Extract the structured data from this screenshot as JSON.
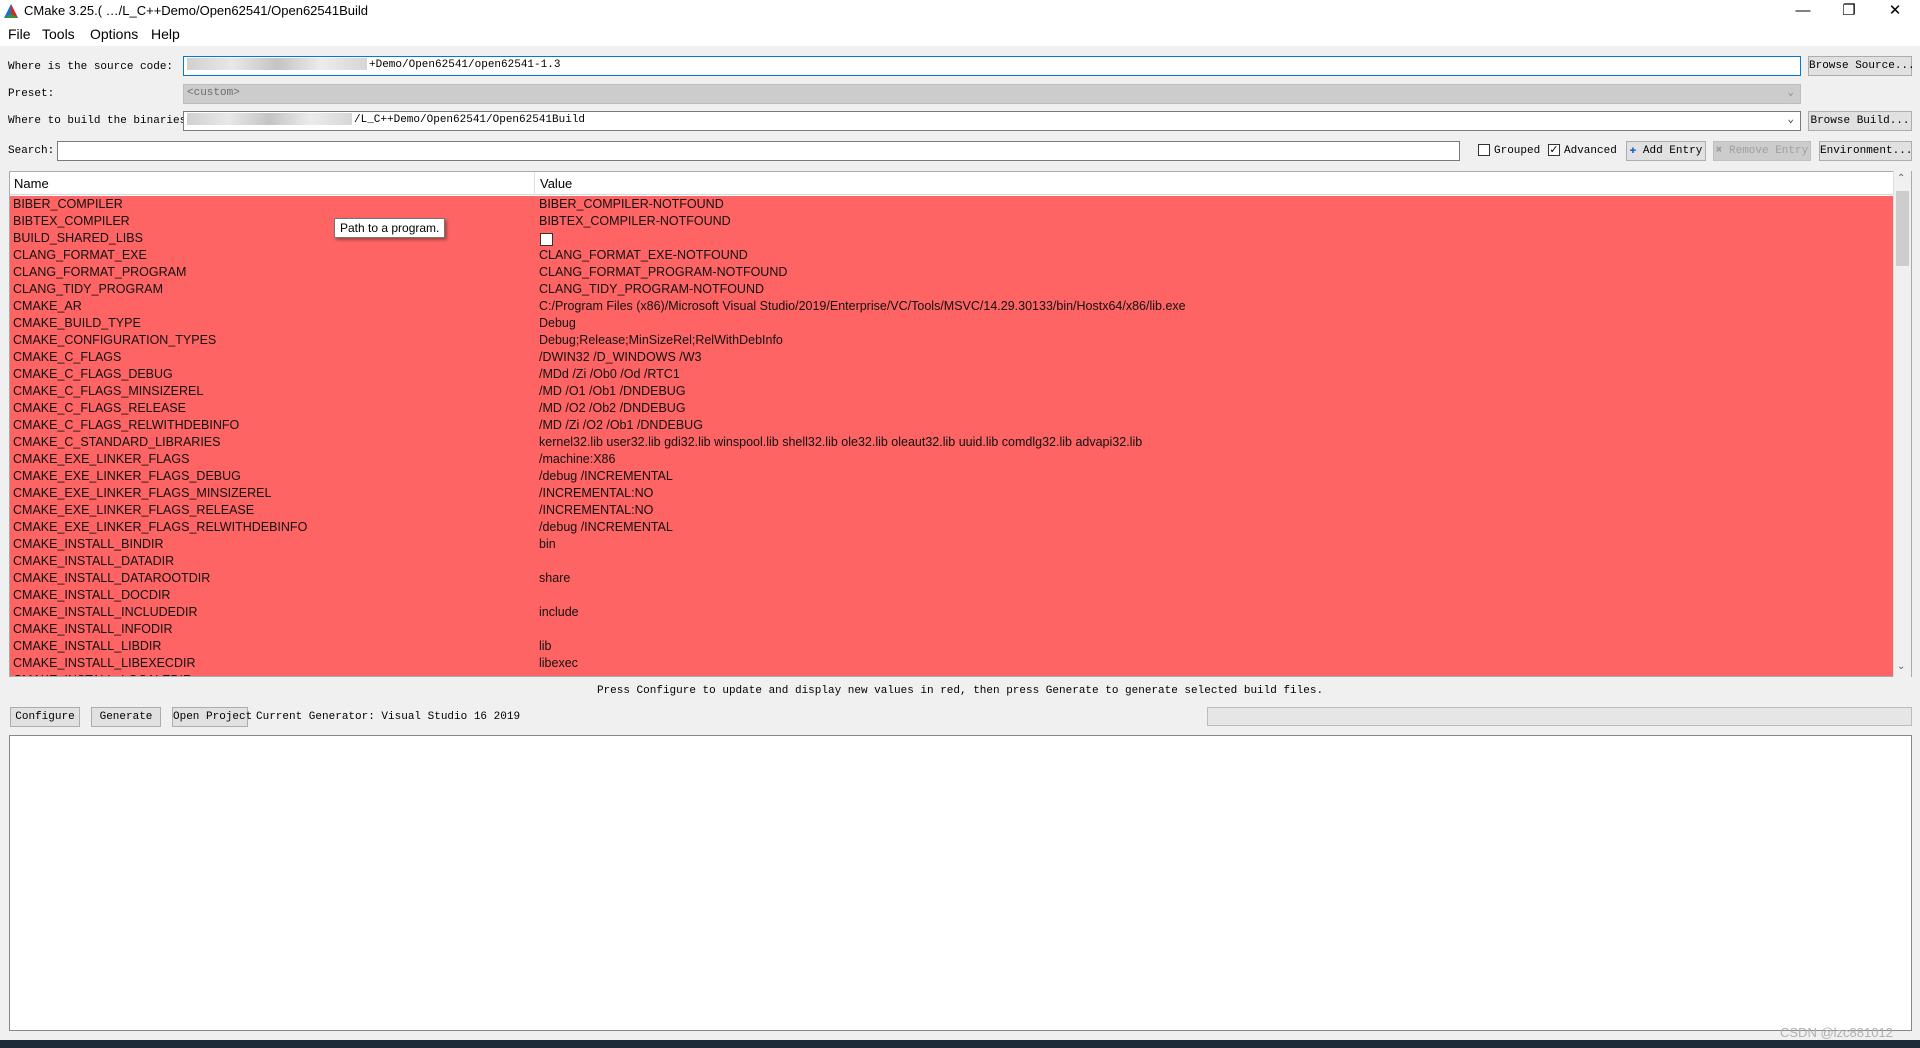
{
  "window": {
    "title": "CMake 3.25.( …/L_C++Demo/Open62541/Open62541Build",
    "minimize_glyph": "—",
    "restore_glyph": "❐",
    "close_glyph": "✕",
    "app_icon": "cmake-triangle-icon"
  },
  "menu": {
    "file": "File",
    "tools": "Tools",
    "options": "Options",
    "help": "Help"
  },
  "source": {
    "label": "Where is the source code:",
    "value": "+Demo/Open62541/open62541-1.3",
    "button": "Browse Source..."
  },
  "preset": {
    "label": "Preset:",
    "value": "<custom>"
  },
  "binaries": {
    "label": "Where to build the binaries:",
    "value": "/L_C++Demo/Open62541/Open62541Build",
    "button": "Browse Build..."
  },
  "search": {
    "label": "Search:",
    "value": "",
    "grouped": "Grouped",
    "grouped_checked": false,
    "advanced": "Advanced",
    "advanced_checked": true,
    "add_entry": "Add Entry",
    "remove_entry": "Remove Entry",
    "environment": "Environment..."
  },
  "table": {
    "col_name": "Name",
    "col_value": "Value",
    "row_color": "#ff6464",
    "rows": [
      {
        "name": "BIBER_COMPILER",
        "value": "BIBER_COMPILER-NOTFOUND"
      },
      {
        "name": "BIBTEX_COMPILER",
        "value": "BIBTEX_COMPILER-NOTFOUND"
      },
      {
        "name": "BUILD_SHARED_LIBS",
        "value": "",
        "checkbox": true
      },
      {
        "name": "CLANG_FORMAT_EXE",
        "value": "CLANG_FORMAT_EXE-NOTFOUND"
      },
      {
        "name": "CLANG_FORMAT_PROGRAM",
        "value": "CLANG_FORMAT_PROGRAM-NOTFOUND"
      },
      {
        "name": "CLANG_TIDY_PROGRAM",
        "value": "CLANG_TIDY_PROGRAM-NOTFOUND"
      },
      {
        "name": "CMAKE_AR",
        "value": "C:/Program Files (x86)/Microsoft Visual Studio/2019/Enterprise/VC/Tools/MSVC/14.29.30133/bin/Hostx64/x86/lib.exe"
      },
      {
        "name": "CMAKE_BUILD_TYPE",
        "value": "Debug"
      },
      {
        "name": "CMAKE_CONFIGURATION_TYPES",
        "value": "Debug;Release;MinSizeRel;RelWithDebInfo"
      },
      {
        "name": "CMAKE_C_FLAGS",
        "value": "/DWIN32 /D_WINDOWS /W3"
      },
      {
        "name": "CMAKE_C_FLAGS_DEBUG",
        "value": "/MDd /Zi /Ob0 /Od /RTC1"
      },
      {
        "name": "CMAKE_C_FLAGS_MINSIZEREL",
        "value": "/MD /O1 /Ob1 /DNDEBUG"
      },
      {
        "name": "CMAKE_C_FLAGS_RELEASE",
        "value": "/MD /O2 /Ob2 /DNDEBUG"
      },
      {
        "name": "CMAKE_C_FLAGS_RELWITHDEBINFO",
        "value": "/MD /Zi /O2 /Ob1 /DNDEBUG"
      },
      {
        "name": "CMAKE_C_STANDARD_LIBRARIES",
        "value": "kernel32.lib user32.lib gdi32.lib winspool.lib shell32.lib ole32.lib oleaut32.lib uuid.lib comdlg32.lib advapi32.lib"
      },
      {
        "name": "CMAKE_EXE_LINKER_FLAGS",
        "value": "/machine:X86"
      },
      {
        "name": "CMAKE_EXE_LINKER_FLAGS_DEBUG",
        "value": "/debug /INCREMENTAL"
      },
      {
        "name": "CMAKE_EXE_LINKER_FLAGS_MINSIZEREL",
        "value": "/INCREMENTAL:NO"
      },
      {
        "name": "CMAKE_EXE_LINKER_FLAGS_RELEASE",
        "value": "/INCREMENTAL:NO"
      },
      {
        "name": "CMAKE_EXE_LINKER_FLAGS_RELWITHDEBINFO",
        "value": "/debug /INCREMENTAL"
      },
      {
        "name": "CMAKE_INSTALL_BINDIR",
        "value": "bin"
      },
      {
        "name": "CMAKE_INSTALL_DATADIR",
        "value": ""
      },
      {
        "name": "CMAKE_INSTALL_DATAROOTDIR",
        "value": "share"
      },
      {
        "name": "CMAKE_INSTALL_DOCDIR",
        "value": ""
      },
      {
        "name": "CMAKE_INSTALL_INCLUDEDIR",
        "value": "include"
      },
      {
        "name": "CMAKE_INSTALL_INFODIR",
        "value": ""
      },
      {
        "name": "CMAKE_INSTALL_LIBDIR",
        "value": "lib"
      },
      {
        "name": "CMAKE_INSTALL_LIBEXECDIR",
        "value": "libexec"
      },
      {
        "name": "CMAKE_INSTALL_LOCALEDIR",
        "value": ""
      }
    ]
  },
  "tooltip": "Path to a program.",
  "status_text": "Press Configure to update and display new values in red, then press Generate to generate selected build files.",
  "actions": {
    "configure": "Configure",
    "generate": "Generate",
    "open_project": "Open Project",
    "generator": "Current Generator: Visual Studio 16 2019"
  },
  "progress": 0,
  "watermark": "CSDN @lzc881012"
}
